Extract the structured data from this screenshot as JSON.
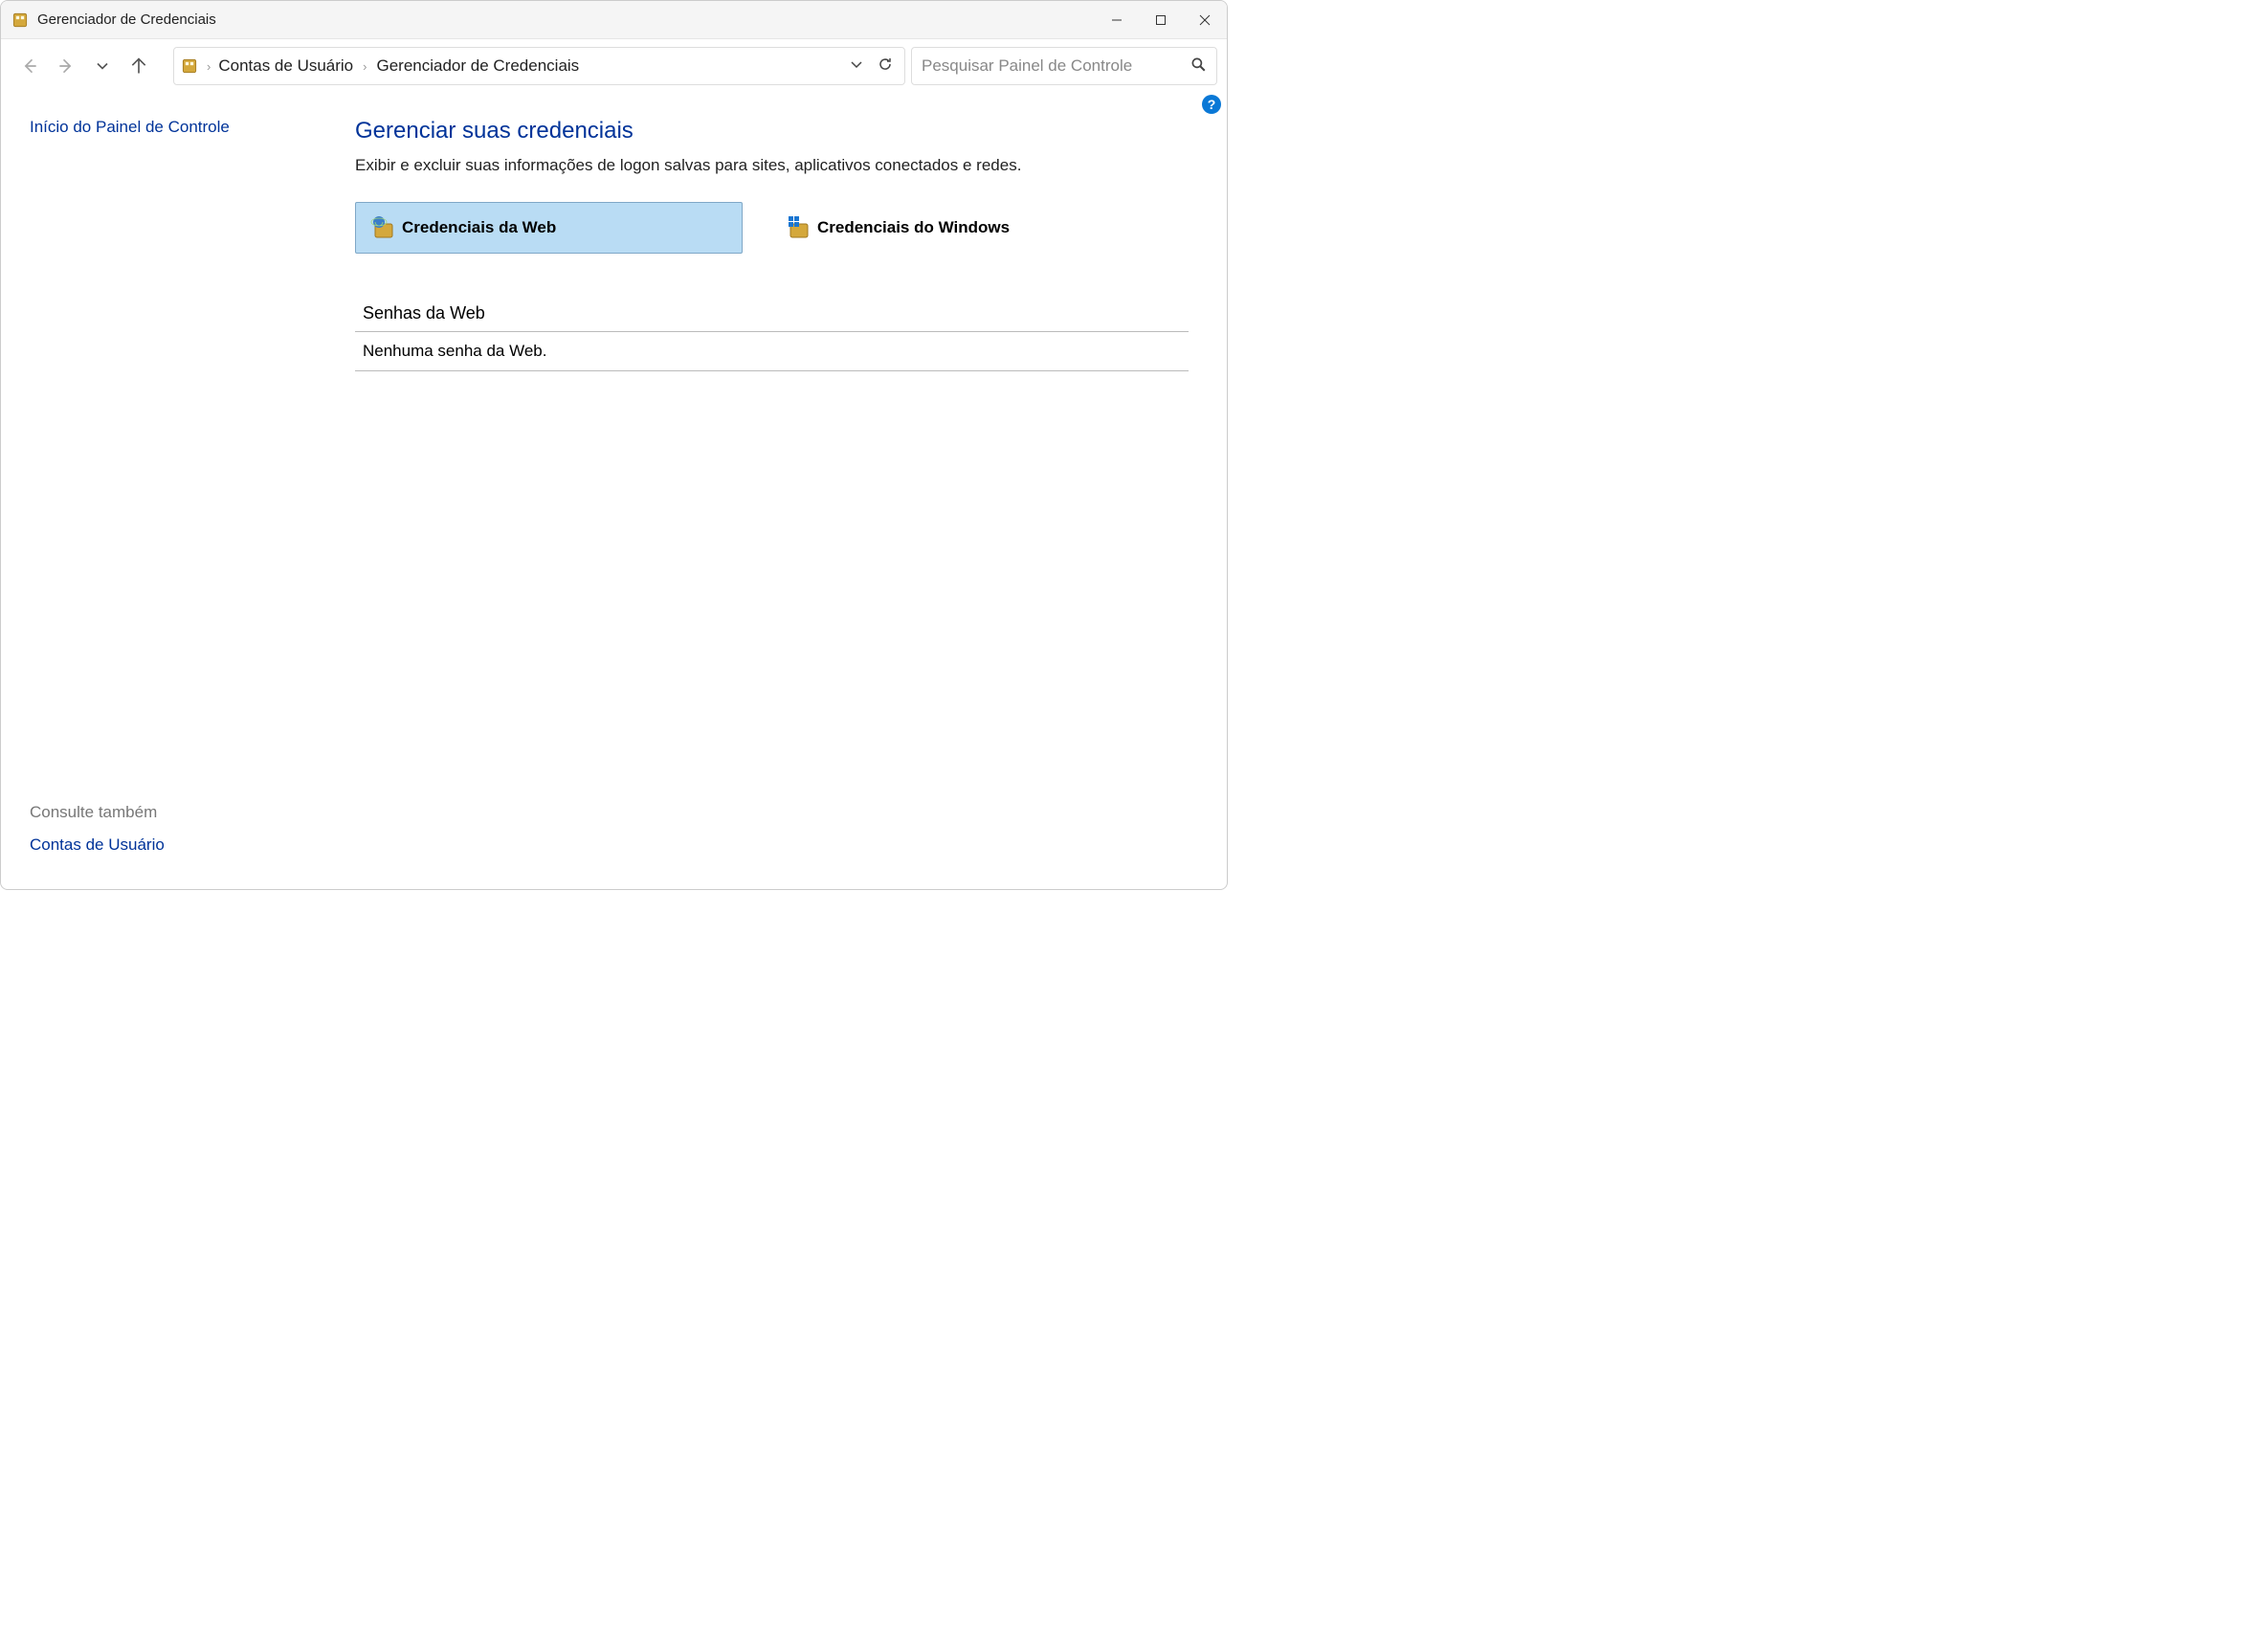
{
  "window": {
    "title": "Gerenciador de Credenciais"
  },
  "toolbar": {
    "breadcrumb": {
      "item1": "Contas de Usuário",
      "item2": "Gerenciador de Credenciais",
      "separator": "›"
    },
    "search_placeholder": "Pesquisar Painel de Controle"
  },
  "sidebar": {
    "home_link": "Início do Painel de Controle",
    "see_also_heading": "Consulte também",
    "see_also_link": "Contas de Usuário"
  },
  "main": {
    "heading": "Gerenciar suas credenciais",
    "description": "Exibir e excluir suas informações de logon salvas para sites, aplicativos conectados e redes.",
    "tabs": {
      "web": "Credenciais da Web",
      "windows": "Credenciais do Windows"
    },
    "section_header": "Senhas da Web",
    "empty_text": "Nenhuma senha da Web."
  },
  "help": {
    "symbol": "?"
  }
}
